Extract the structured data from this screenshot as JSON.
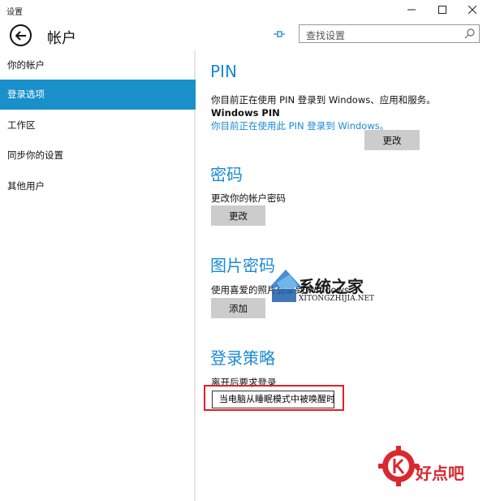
{
  "window": {
    "title": "设置"
  },
  "header": {
    "page_title": "帐户",
    "search_placeholder": "查找设置"
  },
  "sidebar": {
    "items": [
      {
        "label": "你的帐户",
        "active": false
      },
      {
        "label": "登录选项",
        "active": true
      },
      {
        "label": "工作区",
        "active": false
      },
      {
        "label": "同步你的设置",
        "active": false
      },
      {
        "label": "其他用户",
        "active": false
      }
    ]
  },
  "pin": {
    "title": "PIN",
    "description": "你目前正在使用 PIN 登录到 Windows、应用和服务。",
    "subheading": "Windows PIN",
    "link": "你目前正在使用此 PIN 登录到 Windows。",
    "button": "更改"
  },
  "password": {
    "title": "密码",
    "description": "更改你的帐户密码",
    "button": "更改"
  },
  "picture_password": {
    "title": "图片密码",
    "description": "使用喜爱的照片登录到 Windows",
    "button": "添加"
  },
  "sign_in_policy": {
    "title": "登录策略",
    "description": "离开后要求登录",
    "selected_option": "当电脑从睡眠模式中被唤醒时"
  },
  "watermarks": {
    "site1": "系统之家",
    "site1_sub": "XITONGZHIJIA.NET",
    "site2": "好点吧"
  },
  "colors": {
    "accent": "#1a8ad4",
    "nav_active": "#1990c9",
    "highlight_box": "#e0202a"
  }
}
